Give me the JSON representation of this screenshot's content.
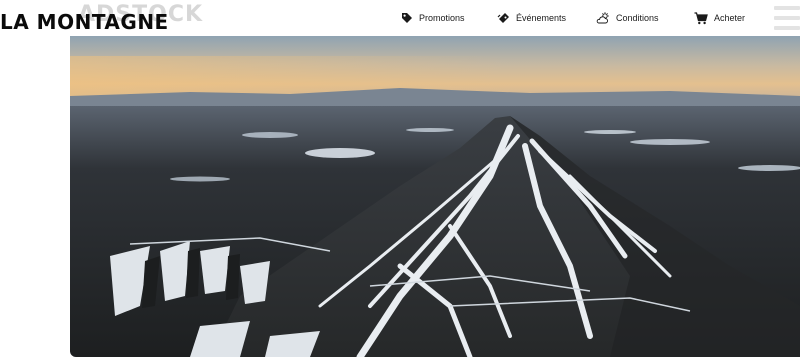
{
  "header": {
    "logo_text": "LA MONTAGNE",
    "watermark_text": "ADSTOCK",
    "nav": [
      {
        "label": "Promotions",
        "icon": "tag-icon"
      },
      {
        "label": "Événements",
        "icon": "ticket-icon"
      },
      {
        "label": "Conditions",
        "icon": "weather-icon"
      },
      {
        "label": "Acheter",
        "icon": "cart-icon"
      }
    ],
    "menu_icon": "hamburger-menu-icon"
  },
  "hero": {
    "image": "aerial-ski-mountain-photo"
  },
  "colors": {
    "text": "#1a1a1a",
    "watermark": "#d7d7d7",
    "menu": "#e3e3e3"
  }
}
